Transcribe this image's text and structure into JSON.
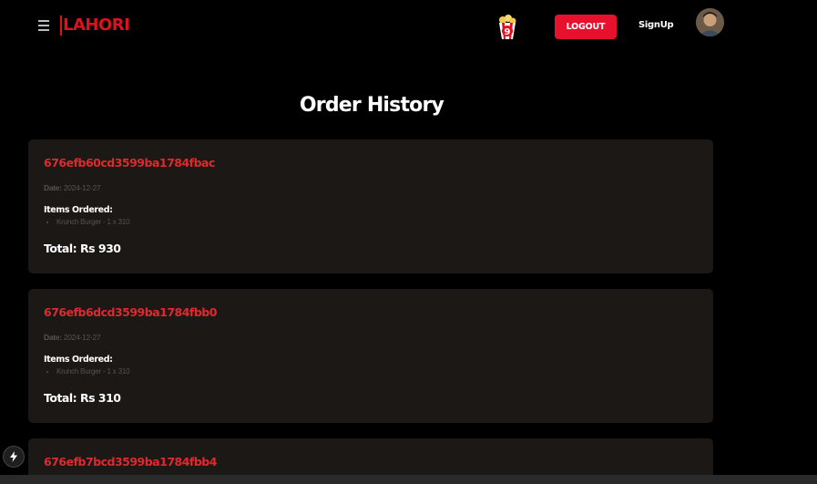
{
  "nav": {
    "brand": "LAHORI",
    "cart_count": "9",
    "logout_label": "LOGOUT",
    "signup_label": "SignUp"
  },
  "page": {
    "title": "Order History"
  },
  "labels": {
    "date": "Date:",
    "items_ordered": "Items Ordered:"
  },
  "orders": [
    {
      "id": "676efb60cd3599ba1784fbac",
      "date": "2024-12-27",
      "items": [
        "Krunch Burger - 1 x 310"
      ],
      "total": "Total: Rs 930"
    },
    {
      "id": "676efb6dcd3599ba1784fbb0",
      "date": "2024-12-27",
      "items": [
        "Krunch Burger - 1 x 310"
      ],
      "total": "Total: Rs 310"
    },
    {
      "id": "676efb7bcd3599ba1784fbb4"
    }
  ],
  "colors": {
    "accent": "#e8112d",
    "order_id": "#e0292e",
    "card_bg": "#1b1816",
    "background": "#000000"
  }
}
